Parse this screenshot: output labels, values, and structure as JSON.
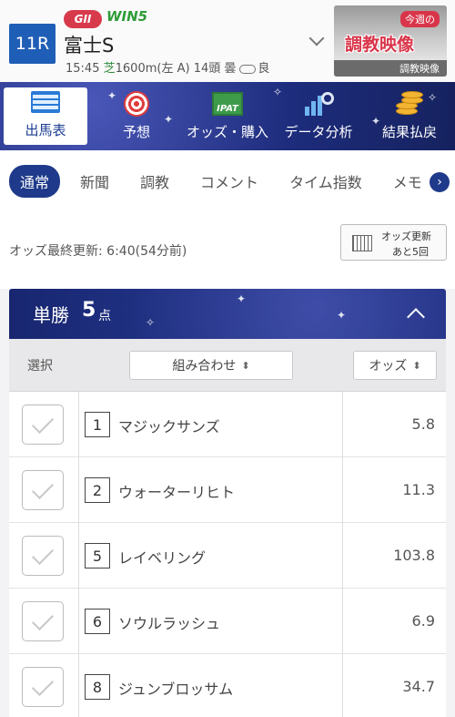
{
  "race": {
    "number": "11R",
    "grade": "GII",
    "win5": "WIN5",
    "name": "富士S",
    "start_time": "15:45",
    "surface": "芝",
    "distance_course": "1600m(左 A)",
    "field_size": "14頭",
    "weather": "曇",
    "track_condition": "良"
  },
  "training_video": {
    "badge": "今週の",
    "title": "調教映像",
    "caption": "調教映像"
  },
  "main_nav": [
    {
      "label": "出馬表",
      "icon": "race-card-icon",
      "active": true
    },
    {
      "label": "予想",
      "icon": "target-icon"
    },
    {
      "label": "オッズ・購入",
      "icon": "ipat-icon",
      "icon_text": "IPAT"
    },
    {
      "label": "データ分析",
      "icon": "chart-search-icon"
    },
    {
      "label": "結果払戻",
      "icon": "coins-icon"
    }
  ],
  "sub_tabs": [
    "通常",
    "新聞",
    "調教",
    "コメント",
    "タイム指数",
    "メモ"
  ],
  "sub_tabs_active": "通常",
  "odds_update": {
    "label": "オッズ最終更新: 6:40(54分前)",
    "refresh_line1": "オッズ更新",
    "refresh_line2": "あと5回"
  },
  "bet_panel": {
    "type": "単勝",
    "count": "5",
    "count_unit": "点",
    "columns": {
      "select": "選択",
      "combo": "組み合わせ",
      "odds": "オッズ"
    },
    "sort_glyph": "⬍"
  },
  "rows": [
    {
      "num": "1",
      "name": "マジックサンズ",
      "odds": "5.8"
    },
    {
      "num": "2",
      "name": "ウォーターリヒト",
      "odds": "11.3"
    },
    {
      "num": "5",
      "name": "レイベリング",
      "odds": "103.8"
    },
    {
      "num": "6",
      "name": "ソウルラッシュ",
      "odds": "6.9"
    },
    {
      "num": "8",
      "name": "ジュンブロッサム",
      "odds": "34.7"
    }
  ],
  "colors": {
    "navy": "#1f3a8a",
    "grade_red": "#d73a4b",
    "win5_green": "#2f9c38",
    "race_blue": "#1f5eb6"
  }
}
